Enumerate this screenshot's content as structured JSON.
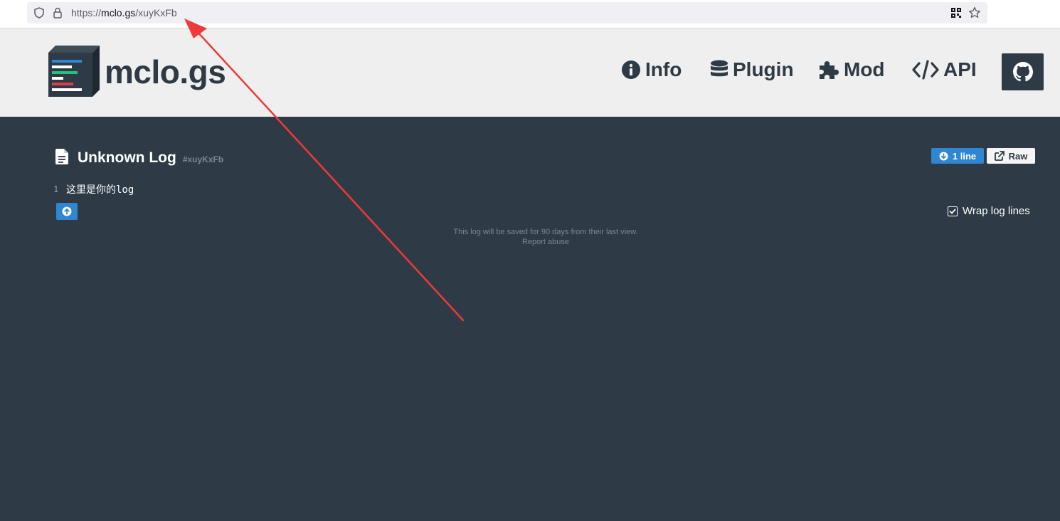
{
  "browser": {
    "url_prefix": "https://",
    "url_host": "mclo.gs",
    "url_path": "/xuyKxFb"
  },
  "header": {
    "brand": "mclo.gs",
    "nav": [
      {
        "label": "Info",
        "icon": "info-circle-icon"
      },
      {
        "label": "Plugin",
        "icon": "database-icon"
      },
      {
        "label": "Mod",
        "icon": "puzzle-icon"
      },
      {
        "label": "API",
        "icon": "code-icon"
      }
    ],
    "github_icon": "github-icon"
  },
  "log": {
    "title": "Unknown Log",
    "id": "#xuyKxFb",
    "lines_label": "1 line",
    "raw_label": "Raw",
    "lines": [
      {
        "number": "1",
        "text": "这里是你的log"
      }
    ],
    "wrap_label": "Wrap log lines",
    "wrap_checked": true
  },
  "footer": {
    "retention": "This log will be saved for 90 days from their last view.",
    "report": "Report abuse"
  },
  "colors": {
    "background": "#2e3a45",
    "header": "#efefef",
    "accent": "#2f86d1",
    "annotation_arrow": "#ee3a3a"
  }
}
